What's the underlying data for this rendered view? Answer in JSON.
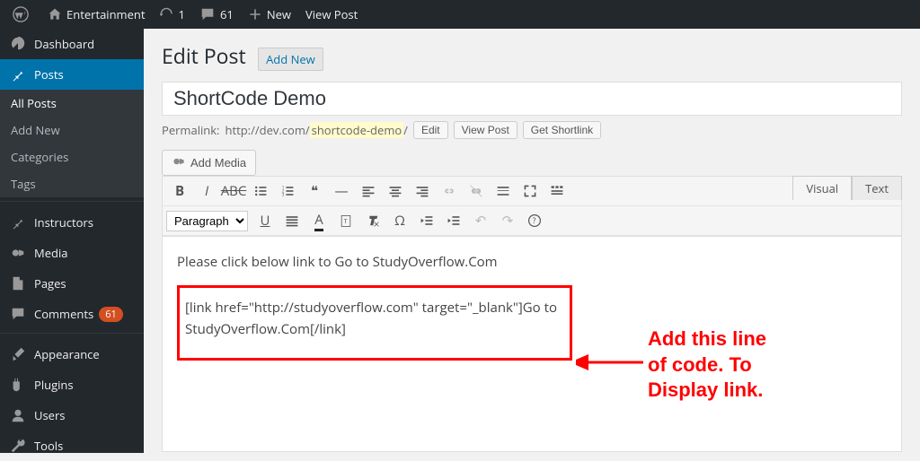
{
  "adminbar": {
    "site_title": "Entertainment",
    "updates_count": "1",
    "comments_count": "61",
    "new_label": "New",
    "view_post": "View Post"
  },
  "sidebar": {
    "dashboard": "Dashboard",
    "posts": "Posts",
    "posts_sub": [
      "All Posts",
      "Add New",
      "Categories",
      "Tags"
    ],
    "instructors": "Instructors",
    "media": "Media",
    "pages": "Pages",
    "comments": "Comments",
    "comments_badge": "61",
    "appearance": "Appearance",
    "plugins": "Plugins",
    "users": "Users",
    "tools": "Tools"
  },
  "page": {
    "title": "Edit Post",
    "add_new": "Add New",
    "post_title": "ShortCode Demo",
    "permalink_label": "Permalink:",
    "permalink_base": "http://dev.com/",
    "permalink_slug": "shortcode-demo",
    "edit_btn": "Edit",
    "view_post_btn": "View Post",
    "get_shortlink_btn": "Get Shortlink",
    "add_media": "Add Media",
    "tab_visual": "Visual",
    "tab_text": "Text",
    "format_label": "Paragraph"
  },
  "editor": {
    "line1": "Please click below link to Go to StudyOverflow.Com",
    "code_line1": "[link href=\"http://studyoverflow.com\" target=\"_blank\"]Go to",
    "code_line2": "StudyOverflow.Com[/link]"
  },
  "annotation": {
    "l1": "Add this line",
    "l2": "of code. To",
    "l3": "Display link."
  }
}
